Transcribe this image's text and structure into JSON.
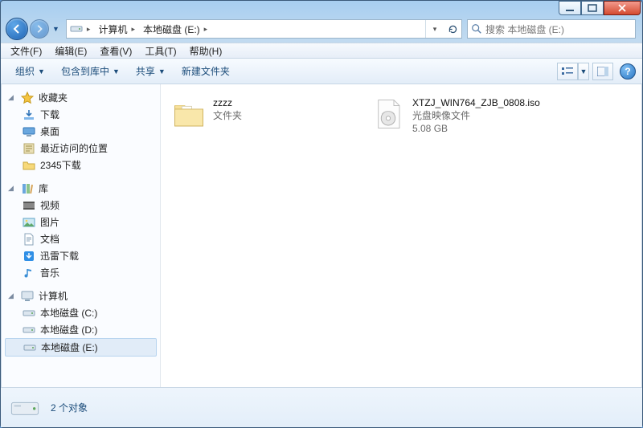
{
  "window": {
    "buttons": {
      "min": "minimize",
      "max": "maximize",
      "close": "close"
    }
  },
  "breadcrumbs": [
    {
      "label": "计算机"
    },
    {
      "label": "本地磁盘 (E:)"
    }
  ],
  "search": {
    "placeholder": "搜索 本地磁盘 (E:)"
  },
  "menubar": [
    "文件(F)",
    "编辑(E)",
    "查看(V)",
    "工具(T)",
    "帮助(H)"
  ],
  "toolbar": {
    "organize": "组织",
    "include": "包含到库中",
    "share": "共享",
    "newfolder": "新建文件夹"
  },
  "sidebar": {
    "favorites": {
      "title": "收藏夹",
      "items": [
        {
          "icon": "download",
          "label": "下载"
        },
        {
          "icon": "desktop",
          "label": "桌面"
        },
        {
          "icon": "recent",
          "label": "最近访问的位置"
        },
        {
          "icon": "folder",
          "label": "2345下载"
        }
      ]
    },
    "libraries": {
      "title": "库",
      "items": [
        {
          "icon": "video",
          "label": "视频"
        },
        {
          "icon": "picture",
          "label": "图片"
        },
        {
          "icon": "doc",
          "label": "文档"
        },
        {
          "icon": "xunlei",
          "label": "迅雷下载"
        },
        {
          "icon": "music",
          "label": "音乐"
        }
      ]
    },
    "computer": {
      "title": "计算机",
      "items": [
        {
          "icon": "drive",
          "label": "本地磁盘 (C:)"
        },
        {
          "icon": "drive",
          "label": "本地磁盘 (D:)"
        },
        {
          "icon": "drive",
          "label": "本地磁盘 (E:)",
          "selected": true
        }
      ]
    }
  },
  "files": [
    {
      "kind": "folder",
      "name": "zzzz",
      "sub1": "文件夹",
      "sub2": ""
    },
    {
      "kind": "iso",
      "name": "XTZJ_WIN764_ZJB_0808.iso",
      "sub1": "光盘映像文件",
      "sub2": "5.08 GB"
    }
  ],
  "details": {
    "count": "2 个对象"
  }
}
